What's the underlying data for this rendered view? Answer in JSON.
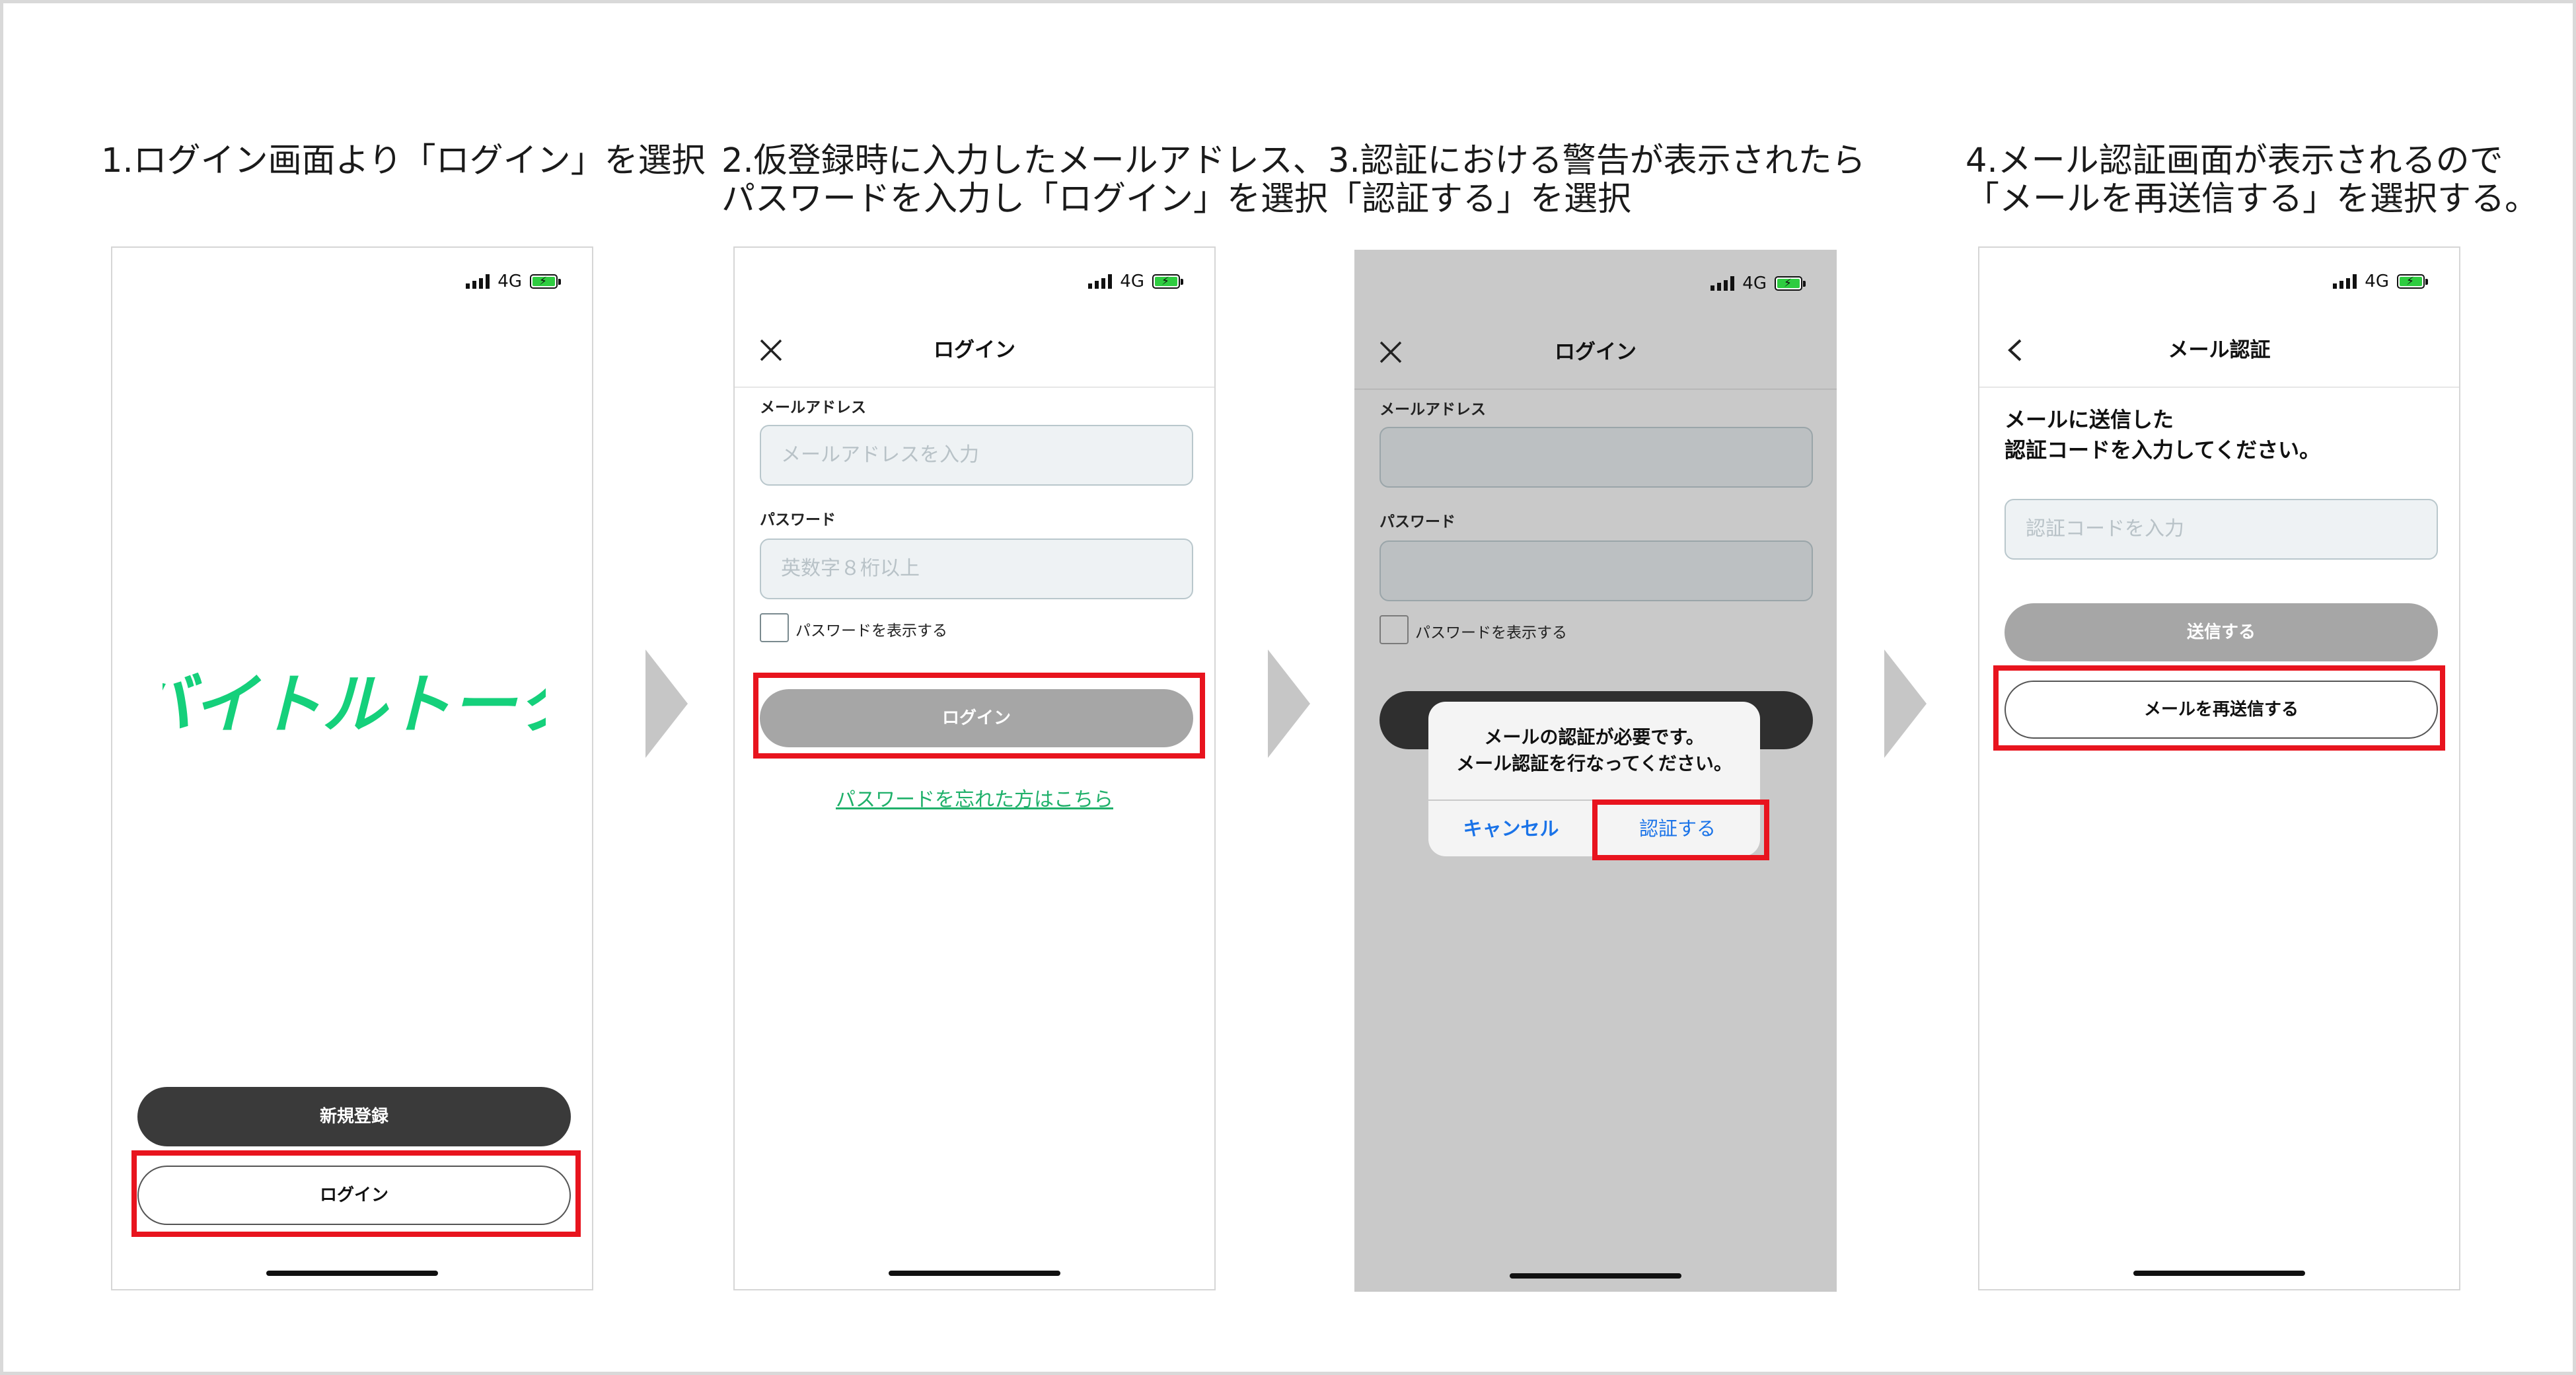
{
  "steps": [
    {
      "title": "1.ログイン画面より「ログイン」を選択",
      "status_net": "4G",
      "logo": "バイトルトーク",
      "register_button": "新規登録",
      "login_button": "ログイン"
    },
    {
      "title": "2.仮登録時に入力したメールアドレス、\nパスワードを入力し「ログイン」を選択",
      "status_net": "4G",
      "nav_title": "ログイン",
      "email_label": "メールアドレス",
      "email_placeholder": "メールアドレスを入力",
      "password_label": "パスワード",
      "password_placeholder": "英数字８桁以上",
      "show_password_label": "パスワードを表示する",
      "login_button": "ログイン",
      "forgot_link": "パスワードを忘れた方はこちら"
    },
    {
      "title": "3.認証における警告が表示されたら\n「認証する」を選択",
      "status_net": "4G",
      "nav_title": "ログイン",
      "email_label": "メールアドレス",
      "password_label": "パスワード",
      "show_password_label": "パスワードを表示する",
      "dialog_message": "メールの認証が必要です。\nメール認証を行なってください。",
      "dialog_cancel": "キャンセル",
      "dialog_confirm": "認証する"
    },
    {
      "title": "4.メール認証画面が表示されるので\n「メールを再送信する」を選択する。",
      "status_net": "4G",
      "nav_title": "メール認証",
      "instruction": "メールに送信した\n認証コードを入力してください。",
      "code_placeholder": "認証コードを入力",
      "send_button": "送信する",
      "resend_button": "メールを再送信する"
    }
  ],
  "colors": {
    "brand_green": "#15d07b",
    "highlight_red": "#e8141e",
    "dark_button": "#3a3a3a",
    "disabled_button": "#a6a6a6",
    "dim_overlay": "#c9c9c9",
    "dialog_action": "#1a73e8"
  },
  "icons": [
    "signal-icon",
    "battery-icon",
    "close-icon",
    "back-chevron-icon",
    "step-arrow-icon"
  ]
}
